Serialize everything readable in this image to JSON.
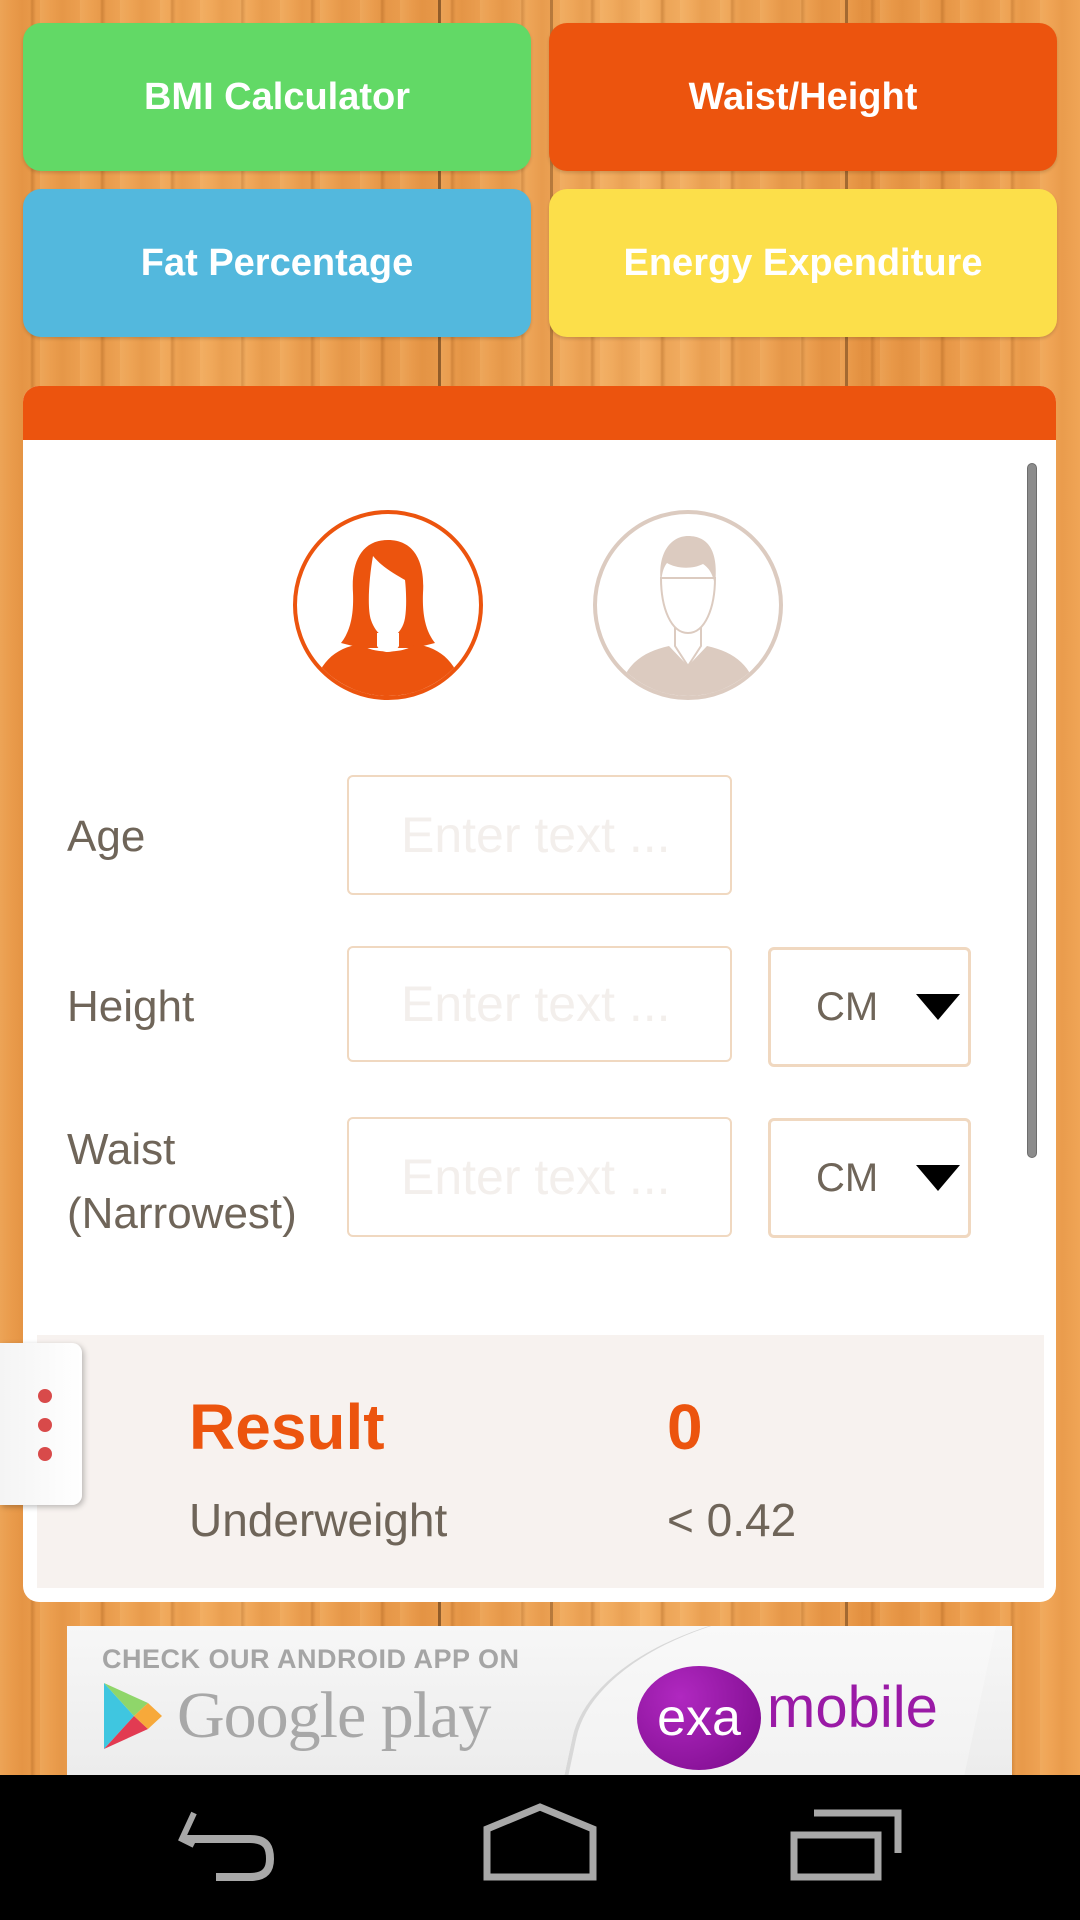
{
  "tiles": [
    {
      "label": "BMI Calculator",
      "color": "#62d966"
    },
    {
      "label": "Waist/Height",
      "color": "#ec540e"
    },
    {
      "label": "Fat Percentage",
      "color": "#53b8dd"
    },
    {
      "label": "Energy Expenditure",
      "color": "#fcdf4a"
    }
  ],
  "gender": {
    "female": {
      "label": "female-selector",
      "selected": true,
      "color": "#ec540e"
    },
    "male": {
      "label": "male-selector",
      "selected": false,
      "color": "#dccbc0"
    }
  },
  "form": {
    "age": {
      "label": "Age",
      "value": "",
      "placeholder": "Enter text ..."
    },
    "height": {
      "label": "Height",
      "value": "",
      "placeholder": "Enter text ...",
      "unit": "CM"
    },
    "waist": {
      "label_line1": "Waist",
      "label_line2": "(Narrowest)",
      "value": "",
      "placeholder": "Enter text ...",
      "unit": "CM"
    }
  },
  "result": {
    "title": "Result",
    "value": "0",
    "category": "Underweight",
    "range": "< 0.42"
  },
  "ad": {
    "headline": "CHECK OUR ANDROID APP ON",
    "store": "Google play",
    "brand_exa": "exa",
    "brand_mobile": "mobile"
  },
  "navbar": {
    "back": "back",
    "home": "home",
    "recents": "recents"
  },
  "colors": {
    "accent": "#ec540e",
    "text": "#6f6559"
  }
}
